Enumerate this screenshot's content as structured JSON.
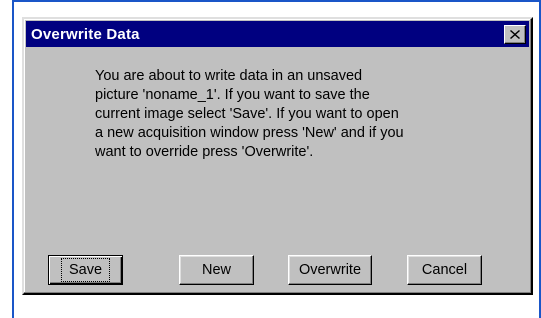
{
  "dialog": {
    "title": "Overwrite Data",
    "message_lines": [
      "You are about to write data in an unsaved",
      "picture 'noname_1'. If you want to save the",
      "current image select 'Save'. If you want to open",
      "a new acquisition window press 'New' and if you",
      "want to override press 'Overwrite'."
    ],
    "buttons": {
      "save": "Save",
      "new": "New",
      "overwrite": "Overwrite",
      "cancel": "Cancel"
    },
    "close_icon": "close-icon"
  },
  "colors": {
    "titlebar": "#000080",
    "dialog_face": "#c0c0c0",
    "page_edge": "#1a56c8"
  }
}
